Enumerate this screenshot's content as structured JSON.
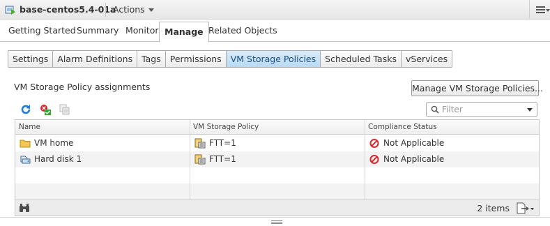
{
  "header": {
    "vm_name": "base-centos5.4-01a",
    "actions_label": "Actions"
  },
  "main_tabs": [
    {
      "label": "Getting Started",
      "active": false
    },
    {
      "label": "Summary",
      "active": false
    },
    {
      "label": "Monitor",
      "active": false
    },
    {
      "label": "Manage",
      "active": true
    },
    {
      "label": "Related Objects",
      "active": false
    }
  ],
  "sub_tabs": [
    {
      "label": "Settings",
      "active": false
    },
    {
      "label": "Alarm Definitions",
      "active": false
    },
    {
      "label": "Tags",
      "active": false
    },
    {
      "label": "Permissions",
      "active": false
    },
    {
      "label": "VM Storage Policies",
      "active": true
    },
    {
      "label": "Scheduled Tasks",
      "active": false
    },
    {
      "label": "vServices",
      "active": false
    }
  ],
  "section": {
    "title": "VM Storage Policy assignments",
    "manage_button_label": "Manage VM Storage Policies...",
    "filter_placeholder": "Filter"
  },
  "toolbar_icons": [
    "refresh-icon",
    "check-compliance-icon",
    "reapply-policy-icon"
  ],
  "table": {
    "columns": [
      "Name",
      "VM Storage Policy",
      "Compliance Status"
    ],
    "rows": [
      {
        "name": "VM home",
        "name_icon": "folder-icon",
        "policy": "FTT=1",
        "status": "Not Applicable"
      },
      {
        "name": "Hard disk 1",
        "name_icon": "hard-disk-icon",
        "policy": "FTT=1",
        "status": "Not Applicable"
      }
    ],
    "footer_count": "2 items"
  },
  "colors": {
    "active_subtab": "#b9d9f3",
    "refresh_blue": "#1f7fd6",
    "status_red": "#d9262b",
    "folder_yellow": "#f3c851"
  }
}
